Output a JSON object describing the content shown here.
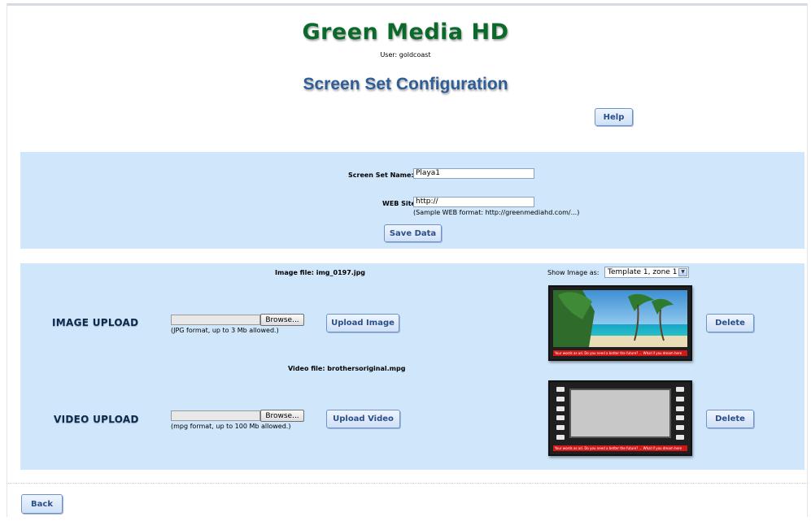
{
  "header": {
    "logo_text": "Green Media HD",
    "user_line": "User: goldcoast",
    "page_title": "Screen Set Configuration",
    "help_label": "Help"
  },
  "config_form": {
    "name_label": "Screen Set Name:",
    "name_value": "Playa1",
    "web_label": "WEB Site:",
    "web_value": "http://",
    "web_hint": "(Sample WEB format: http://greenmediahd.com/...)",
    "save_label": "Save Data"
  },
  "media": {
    "image_file_text": "Image file: img_0197.jpg",
    "show_image_as_label": "Show Image as:",
    "show_image_as_value": "Template 1, zone 1",
    "image_section_label": "IMAGE UPLOAD",
    "image_browse_label": "Browse...",
    "image_hint": "(JPG format, up to 3 Mb allowed.)",
    "upload_image_label": "Upload Image",
    "image_delete_label": "Delete",
    "video_file_text": "Video file: brothersoriginal.mpg",
    "video_section_label": "VIDEO UPLOAD",
    "video_browse_label": "Browse...",
    "video_hint": "(mpg format, up to 100 Mb allowed.)",
    "upload_video_label": "Upload Video",
    "video_delete_label": "Delete",
    "ticker_text": "Your words as ad. Do you need a better the future? ... What if you dream here"
  },
  "footer": {
    "back_label": "Back"
  },
  "colors": {
    "logo_green": "#0b6a2a",
    "title_blue": "#2f5d95",
    "panel_blue": "#cfe6fb",
    "ticker_red": "#d01818"
  }
}
